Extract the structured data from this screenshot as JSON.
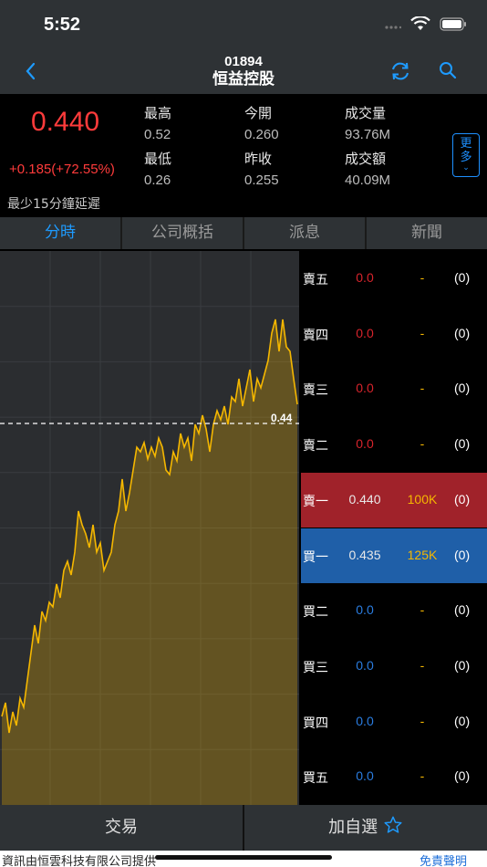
{
  "status": {
    "time": "5:52"
  },
  "nav": {
    "code": "01894",
    "name": "恒益控股"
  },
  "quote": {
    "price": "0.440",
    "change": "+0.185(+72.55%)",
    "delay_note": "最少15分鐘延遲",
    "stats": [
      {
        "label": "最高",
        "value": "0.52"
      },
      {
        "label": "今開",
        "value": "0.260"
      },
      {
        "label": "成交量",
        "value": "93.76M"
      },
      {
        "label": "最低",
        "value": "0.26"
      },
      {
        "label": "昨收",
        "value": "0.255"
      },
      {
        "label": "成交額",
        "value": "40.09M"
      }
    ],
    "more_label": "更多"
  },
  "tabs": [
    "分時",
    "公司概括",
    "派息",
    "新聞"
  ],
  "chart": {
    "current_price_label": "0.44",
    "line_color": "#f5b700"
  },
  "order_book": [
    {
      "label": "賣五",
      "price": "0.0",
      "volume": "-",
      "count": "(0)"
    },
    {
      "label": "賣四",
      "price": "0.0",
      "volume": "-",
      "count": "(0)"
    },
    {
      "label": "賣三",
      "price": "0.0",
      "volume": "-",
      "count": "(0)"
    },
    {
      "label": "賣二",
      "price": "0.0",
      "volume": "-",
      "count": "(0)"
    },
    {
      "label": "賣一",
      "price": "0.440",
      "volume": "100K",
      "count": "(0)"
    },
    {
      "label": "買一",
      "price": "0.435",
      "volume": "125K",
      "count": "(0)"
    },
    {
      "label": "買二",
      "price": "0.0",
      "volume": "-",
      "count": "(0)"
    },
    {
      "label": "買三",
      "price": "0.0",
      "volume": "-",
      "count": "(0)"
    },
    {
      "label": "買四",
      "price": "0.0",
      "volume": "-",
      "count": "(0)"
    },
    {
      "label": "買五",
      "price": "0.0",
      "volume": "-",
      "count": "(0)"
    }
  ],
  "bottom": {
    "trade_label": "交易",
    "watchlist_label": "加自選"
  },
  "footer": {
    "text": "資訊由恒雲科技有限公司提供",
    "disclaimer": "免責聲明"
  },
  "colors": {
    "up": "#ff3b3b",
    "accent": "#1e9bff",
    "ask_bg": "#a0222a",
    "bid_bg": "#1f5fa8"
  }
}
